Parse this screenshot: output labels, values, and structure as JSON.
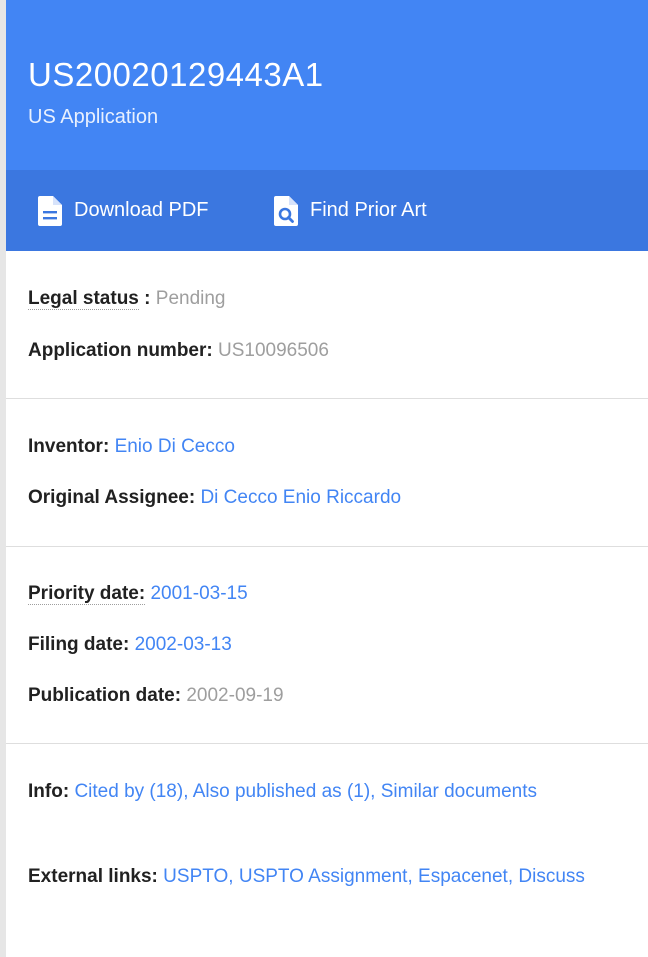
{
  "header": {
    "doc_number": "US20020129443A1",
    "doc_type": "US Application"
  },
  "toolbar": {
    "download_pdf": "Download PDF",
    "find_prior_art": "Find Prior Art"
  },
  "status": {
    "legal_status_label": "Legal status",
    "legal_status_sep": " : ",
    "legal_status_value": "Pending",
    "application_number_label": "Application number:",
    "application_number_value": "US10096506"
  },
  "people": {
    "inventor_label": "Inventor:",
    "inventor_value": "Enio Di Cecco",
    "assignee_label": "Original Assignee:",
    "assignee_value": "Di Cecco Enio Riccardo"
  },
  "dates": {
    "priority_label": "Priority date:",
    "priority_value": "2001-03-15",
    "filing_label": "Filing date:",
    "filing_value": "2002-03-13",
    "publication_label": "Publication date:",
    "publication_value": "2002-09-19"
  },
  "info": {
    "label": "Info:",
    "links": [
      "Cited by (18)",
      "Also published as (1)",
      "Similar documents"
    ],
    "external_label": "External links:",
    "external_links": [
      "USPTO",
      "USPTO Assignment",
      "Espacenet",
      "Discuss"
    ],
    "separator": ","
  },
  "colors": {
    "header_blue": "#4285f4",
    "toolbar_blue": "#3b77e0",
    "link_blue": "#4285f4",
    "muted_grey": "#9e9e9e"
  }
}
